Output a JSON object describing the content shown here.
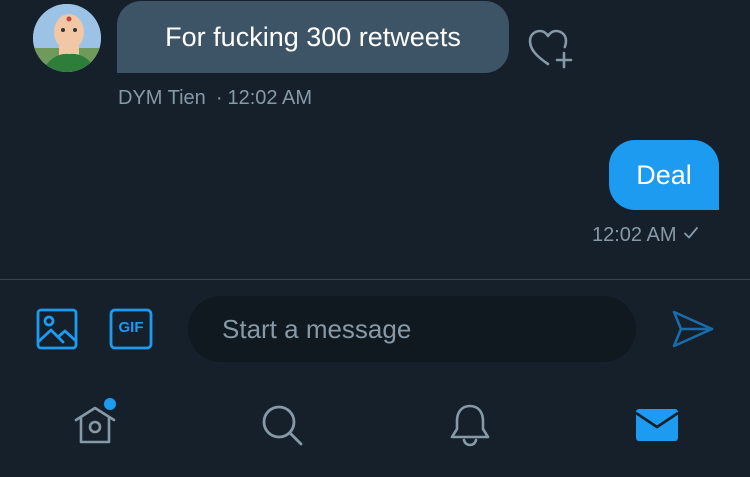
{
  "conversation": {
    "received": {
      "text": "For fucking 300 retweets",
      "sender": "DYM Tien",
      "separator": "·",
      "time": "12:02 AM",
      "avatar_icon": "user-avatar",
      "reaction_icon": "heart-plus-icon"
    },
    "sent": {
      "text": "Deal",
      "time": "12:02 AM",
      "status_icon": "checkmark-icon"
    }
  },
  "composer": {
    "placeholder": "Start a message",
    "image_icon": "image-icon",
    "gif_label": "GIF",
    "send_icon": "send-icon"
  },
  "tabbar": {
    "items": [
      {
        "name": "home",
        "icon": "home-icon",
        "has_badge": true
      },
      {
        "name": "search",
        "icon": "search-icon"
      },
      {
        "name": "notifications",
        "icon": "bell-icon"
      },
      {
        "name": "messages",
        "icon": "envelope-icon",
        "active": true
      }
    ]
  },
  "colors": {
    "background": "#15202b",
    "bubble_in": "#3d5466",
    "bubble_out": "#1d9bf0",
    "accent": "#1d9bf0",
    "muted_text": "#8899a6",
    "input_bg": "#101820",
    "icon_gray": "#8899a6"
  }
}
